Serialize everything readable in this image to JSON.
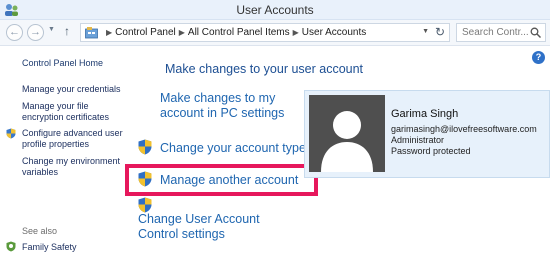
{
  "window": {
    "title": "User Accounts"
  },
  "address_bar": {
    "crumbs": [
      "Control Panel",
      "All Control Panel Items",
      "User Accounts"
    ],
    "search_placeholder": "Search Contr..."
  },
  "left_nav": {
    "home": "Control Panel Home",
    "links": [
      "Manage your credentials",
      "Manage your file encryption certificates",
      "Configure advanced user profile properties",
      "Change my environment variables"
    ],
    "see_also_label": "See also",
    "family_safety": "Family Safety"
  },
  "main": {
    "heading": "Make changes to your user account",
    "tasks": {
      "pc_settings": "Make changes to my account in PC settings",
      "change_type": "Change your account type",
      "manage_another": "Manage another account",
      "uac": "Change User Account Control settings"
    }
  },
  "account": {
    "name": "Garima Singh",
    "email": "garimasingh@ilovefreesoftware.com",
    "role": "Administrator",
    "status": "Password protected"
  },
  "colors": {
    "highlight": "#e6175c",
    "link": "#1f66b0",
    "card_bg": "#e7f1fb"
  },
  "icons": {
    "shield": "uac-shield-icon",
    "help": "help-icon",
    "search": "search-icon"
  }
}
